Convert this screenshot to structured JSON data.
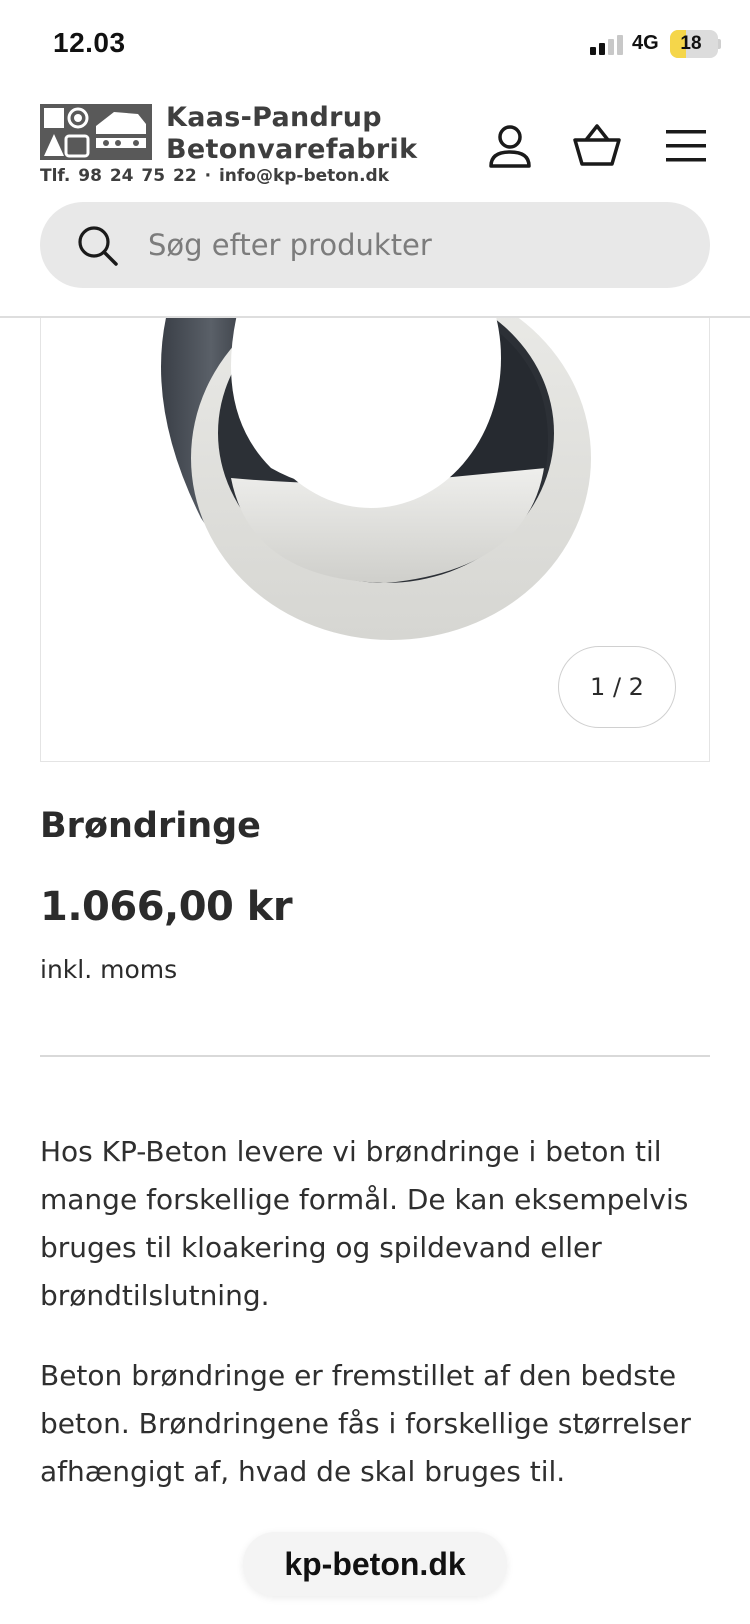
{
  "status_bar": {
    "time": "12.03",
    "network": "4G",
    "battery_level": "18",
    "battery_fraction": 0.18,
    "signal_bars_active": 2,
    "signal_bars_total": 4
  },
  "header": {
    "brand_line1": "Kaas-Pandrup",
    "brand_line2": "Betonvarefabrik",
    "contact": "Tlf. 98 24 75 22  ·  info@kp-beton.dk",
    "icons": [
      "account-icon",
      "basket-icon",
      "menu-icon"
    ]
  },
  "search": {
    "placeholder": "Søg efter produkter",
    "value": ""
  },
  "gallery": {
    "counter": "1 / 2",
    "current_image": 1,
    "total_images": 2
  },
  "product": {
    "title": "Brøndringe",
    "price": "1.066,00 kr",
    "price_note": "inkl. moms",
    "description": [
      "Hos KP-Beton levere vi brøndringe i beton til mange forskellige formål. De kan eksempelvis bruges til kloakering og spildevand eller brøndtilslutning.",
      "Beton brøndringe er fremstillet af den bedste beton. Brøndringene fås i forskellige størrelser afhængigt af, hvad de skal bruges til."
    ]
  },
  "browser": {
    "url": "kp-beton.dk"
  },
  "colors": {
    "text": "#2b2b2b",
    "search_bg": "#e8e8e8",
    "logo_bg": "#595959",
    "battery_low": "#f5d64a"
  }
}
